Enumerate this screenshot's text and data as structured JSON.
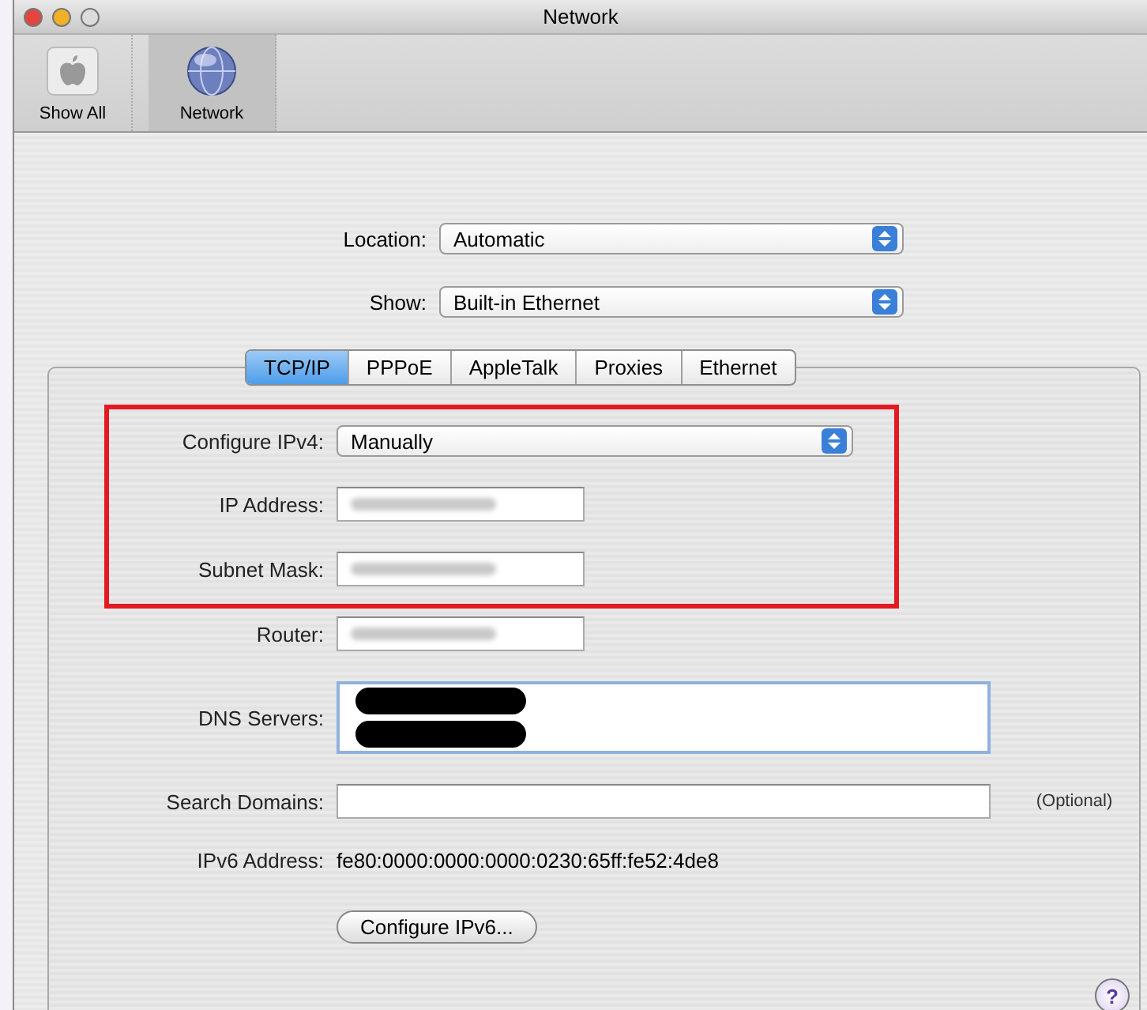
{
  "window": {
    "title": "Network"
  },
  "toolbar": [
    {
      "label": "Show All",
      "kind": "apple",
      "selected": false
    },
    {
      "label": "Network",
      "kind": "globe",
      "selected": true
    }
  ],
  "location": {
    "label": "Location:",
    "value": "Automatic"
  },
  "show": {
    "label": "Show:",
    "value": "Built-in Ethernet"
  },
  "tabs": [
    {
      "label": "TCP/IP",
      "selected": true
    },
    {
      "label": "PPPoE",
      "selected": false
    },
    {
      "label": "AppleTalk",
      "selected": false
    },
    {
      "label": "Proxies",
      "selected": false
    },
    {
      "label": "Ethernet",
      "selected": false
    }
  ],
  "rows": [
    {
      "kind": "popup",
      "label": "Configure IPv4:",
      "value": "Manually",
      "highlighted": true
    },
    {
      "kind": "blurred",
      "label": "IP Address:",
      "highlighted": true
    },
    {
      "kind": "blurred",
      "label": "Subnet Mask:",
      "highlighted": true
    },
    {
      "kind": "blurred",
      "label": "Router:",
      "highlighted": false
    },
    {
      "kind": "redacted",
      "label": "DNS Servers:",
      "highlighted": false
    },
    {
      "kind": "field",
      "label": "Search Domains:",
      "note": "(Optional)",
      "highlighted": false
    },
    {
      "kind": "text",
      "label": "IPv6 Address:",
      "value": "fe80:0000:0000:0000:0230:65ff:fe52:4de8",
      "highlighted": false
    }
  ],
  "button": "Configure IPv6...",
  "help": "?"
}
